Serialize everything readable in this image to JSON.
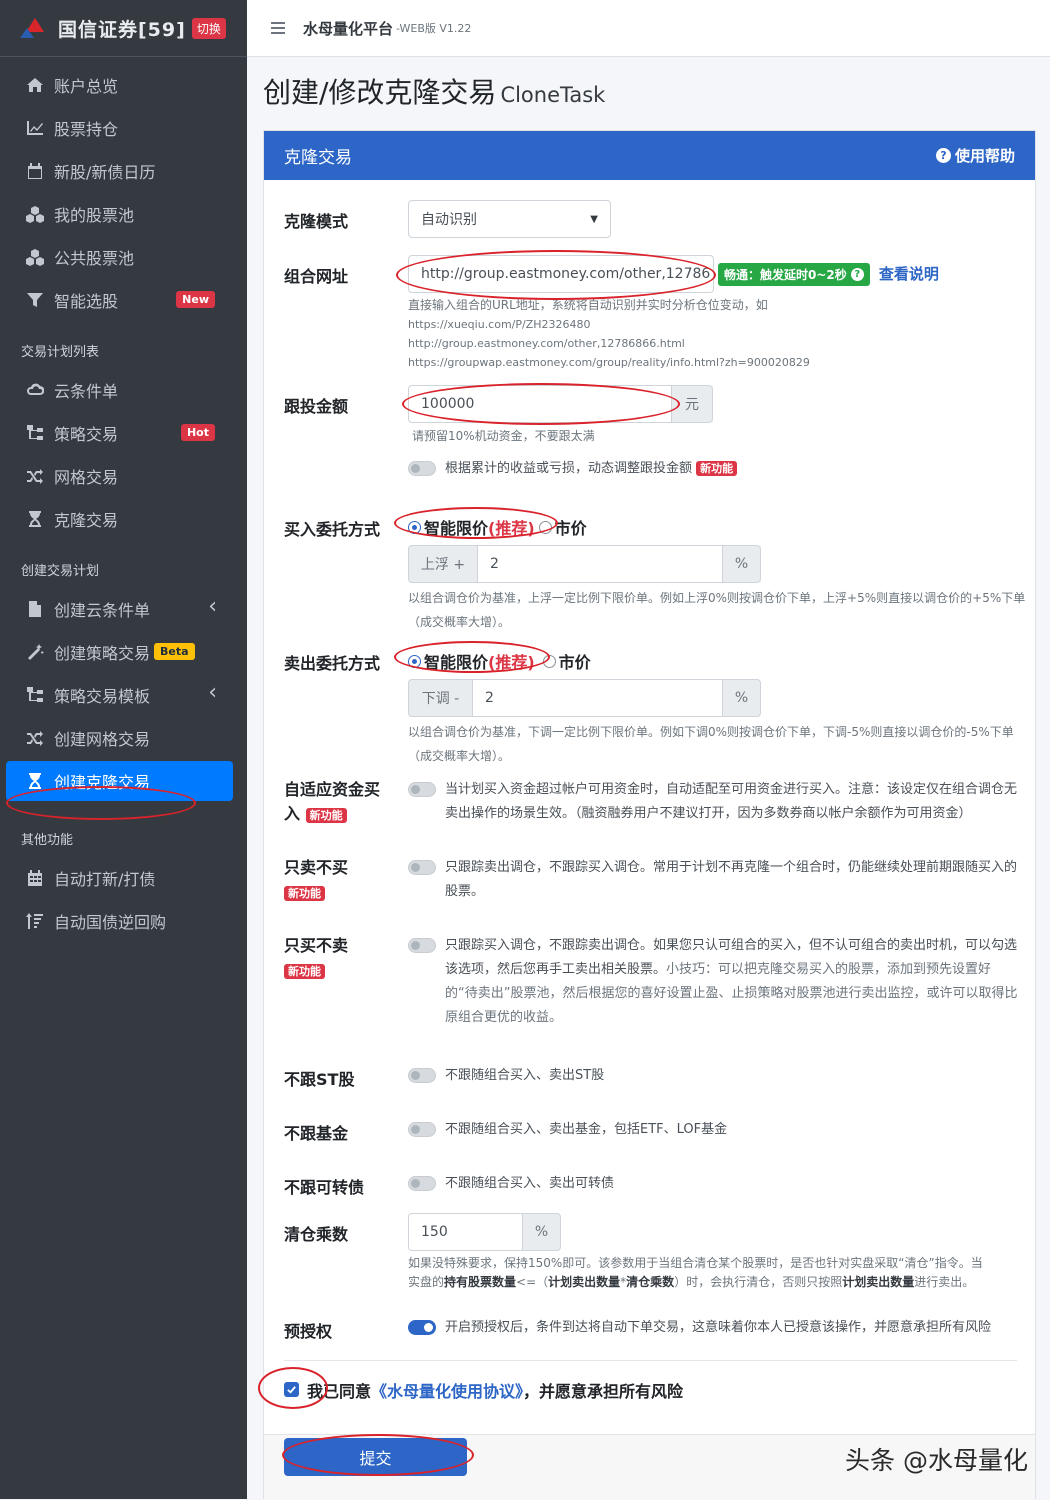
{
  "sidebar": {
    "brand": "国信证券[59]",
    "switch_label": "切换",
    "items_main": [
      {
        "label": "账户总览",
        "icon": "home-icon"
      },
      {
        "label": "股票持仓",
        "icon": "chart-icon"
      },
      {
        "label": "新股/新债日历",
        "icon": "calendar-icon"
      },
      {
        "label": "我的股票池",
        "icon": "cubes-icon"
      },
      {
        "label": "公共股票池",
        "icon": "cubes-icon"
      },
      {
        "label": "智能选股",
        "icon": "filter-icon",
        "badge": "New"
      }
    ],
    "header_plans": "交易计划列表",
    "items_plans": [
      {
        "label": "云条件单",
        "icon": "cloud-icon"
      },
      {
        "label": "策略交易",
        "icon": "sitemap-icon",
        "badge": "Hot"
      },
      {
        "label": "网格交易",
        "icon": "shuffle-icon"
      },
      {
        "label": "克隆交易",
        "icon": "hourglass-icon"
      }
    ],
    "header_create": "创建交易计划",
    "items_create": [
      {
        "label": "创建云条件单",
        "icon": "file-icon"
      },
      {
        "label": "创建策略交易",
        "icon": "magic-icon",
        "badge": "Beta"
      },
      {
        "label": "策略交易模板",
        "icon": "sitemap-icon"
      },
      {
        "label": "创建网格交易",
        "icon": "shuffle-icon"
      },
      {
        "label": "创建克隆交易",
        "icon": "hourglass-icon"
      }
    ],
    "header_other": "其他功能",
    "items_other": [
      {
        "label": "自动打新/打债",
        "icon": "calendar-grid-icon"
      },
      {
        "label": "自动国债逆回购",
        "icon": "sort-icon"
      }
    ]
  },
  "topbar": {
    "title": "水母量化平台",
    "version": "-WEB版 V1.22"
  },
  "page": {
    "title": "创建/修改克隆交易",
    "subtitle": "CloneTask"
  },
  "card": {
    "title": "克隆交易",
    "help": "使用帮助"
  },
  "form": {
    "mode": {
      "label": "克隆模式",
      "value": "自动识别"
    },
    "url": {
      "label": "组合网址",
      "value": "http://group.eastmoney.com/other,12786",
      "status": "畅通：触发延时0~2秒",
      "link": "查看说明",
      "hint": "直接输入组合的URL地址，系统将自动识别并实时分析仓位变动，如",
      "examples": [
        "https://xueqiu.com/P/ZH2326480",
        "http://group.eastmoney.com/other,12786866.html",
        "https://groupwap.eastmoney.com/group/reality/info.html?zh=900020829"
      ]
    },
    "amount": {
      "label": "跟投金额",
      "value": "100000",
      "unit": "元",
      "hint": "请预留10%机动资金，不要跟太满",
      "dynamic_text": "根据累计的收益或亏损，动态调整跟投金额",
      "new_badge": "新功能"
    },
    "buy": {
      "label": "买入委托方式",
      "option_smart": "智能限价",
      "recommend": "(推荐)",
      "option_market": "市价",
      "prefix": "上浮 +",
      "value": "2",
      "unit": "%",
      "hint": "以组合调仓价为基准，上浮一定比例下限价单。例如上浮0%则按调仓价下单，上浮+5%则直接以调仓价的+5%下单（成交概率大增）。"
    },
    "sell": {
      "label": "卖出委托方式",
      "option_smart": "智能限价",
      "recommend": "(推荐)",
      "option_market": "市价",
      "prefix": "下调 -",
      "value": "2",
      "unit": "%",
      "hint": "以组合调仓价为基准，下调一定比例下限价单。例如下调0%则按调仓价下单，下调-5%则直接以调仓价的-5%下单（成交概率大增）。"
    },
    "adaptive": {
      "label_line1": "自适应资金买",
      "label_line2": "入",
      "new_badge": "新功能",
      "text": "当计划买入资金超过帐户可用资金时，自动适配至可用资金进行买入。注意：该设定仅在组合调仓无卖出操作的场景生效。（融资融券用户不建议打开，因为多数券商以帐户余额作为可用资金）"
    },
    "sell_only": {
      "label": "只卖不买",
      "new_badge": "新功能",
      "text": "只跟踪卖出调仓，不跟踪买入调仓。常用于计划不再克隆一个组合时，仍能继续处理前期跟随买入的股票。"
    },
    "buy_only": {
      "label": "只买不卖",
      "new_badge": "新功能",
      "text": "只跟踪买入调仓，不跟踪卖出调仓。如果您只认可组合的买入，但不认可组合的卖出时机，可以勾选该选项，然后您再手工卖出相关股票。",
      "tip": "小技巧：可以把克隆交易买入的股票，添加到预先设置好的“待卖出”股票池，然后根据您的喜好设置止盈、止损策略对股票池进行卖出监控，或许可以取得比原组合更优的收益。"
    },
    "no_st": {
      "label": "不跟ST股",
      "text": "不跟随组合买入、卖出ST股"
    },
    "no_fund": {
      "label": "不跟基金",
      "text": "不跟随组合买入、卖出基金，包括ETF、LOF基金"
    },
    "no_cb": {
      "label": "不跟可转债",
      "text": "不跟随组合买入、卖出可转债"
    },
    "multiplier": {
      "label": "清仓乘数",
      "value": "150",
      "unit": "%",
      "hint_line1": "如果没特殊要求，保持150%即可。该参数用于当组合清仓某个股票时，是否也针对实盘采取“清仓”指令。当",
      "hint_pre": "实盘的",
      "hint_b1": "持有股票数量",
      "hint_mid1": "<=（",
      "hint_b2": "计划卖出数量",
      "hint_mid2": "*",
      "hint_b3": "清仓乘数",
      "hint_mid3": "）时，会执行清仓，否则只按照",
      "hint_b4": "计划卖出数量",
      "hint_post": "进行卖出。"
    },
    "preauth": {
      "label": "预授权",
      "text": "开启预授权后，条件到达将自动下单交易，这意味着你本人已授意该操作，并愿意承担所有风险"
    },
    "agree": {
      "pre": "我已同意",
      "link": "《水母量化使用协议》",
      "post": "，并愿意承担所有风险"
    },
    "submit": "提交"
  },
  "watermark": "头条 @水母量化"
}
